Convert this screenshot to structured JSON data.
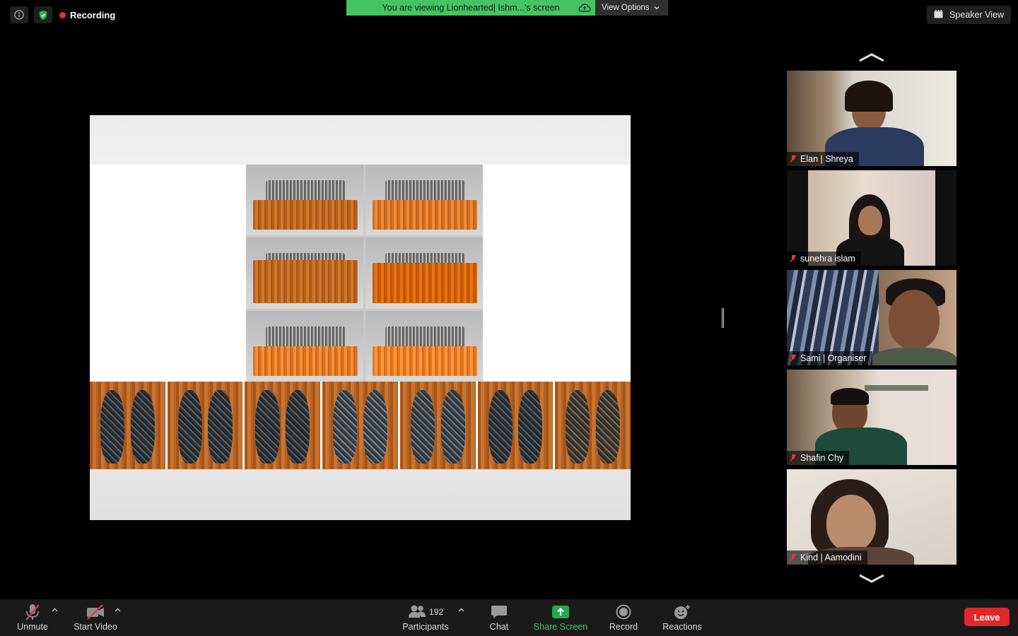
{
  "top_bar": {
    "recording_label": "Recording",
    "banner_text": "You are viewing Lionhearted| Ishm...'s screen",
    "view_options_label": "View Options",
    "speaker_view_label": "Speaker View"
  },
  "participants_panel": {
    "tiles": [
      {
        "name": "Elan | Shreya",
        "muted": true
      },
      {
        "name": "sunehra islam",
        "muted": true
      },
      {
        "name": "Sami | Organiser",
        "muted": true
      },
      {
        "name": "Shafin Chy",
        "muted": true
      },
      {
        "name": "Kind | Aamodini",
        "muted": true
      }
    ]
  },
  "toolbar": {
    "unmute_label": "Unmute",
    "start_video_label": "Start Video",
    "participants_label": "Participants",
    "participants_count": "192",
    "chat_label": "Chat",
    "share_screen_label": "Share Screen",
    "record_label": "Record",
    "reactions_label": "Reactions",
    "leave_label": "Leave"
  },
  "colors": {
    "banner_green": "#47c462",
    "share_green": "#4bc46a",
    "recording_red": "#e5322d",
    "leave_red": "#e02828"
  }
}
